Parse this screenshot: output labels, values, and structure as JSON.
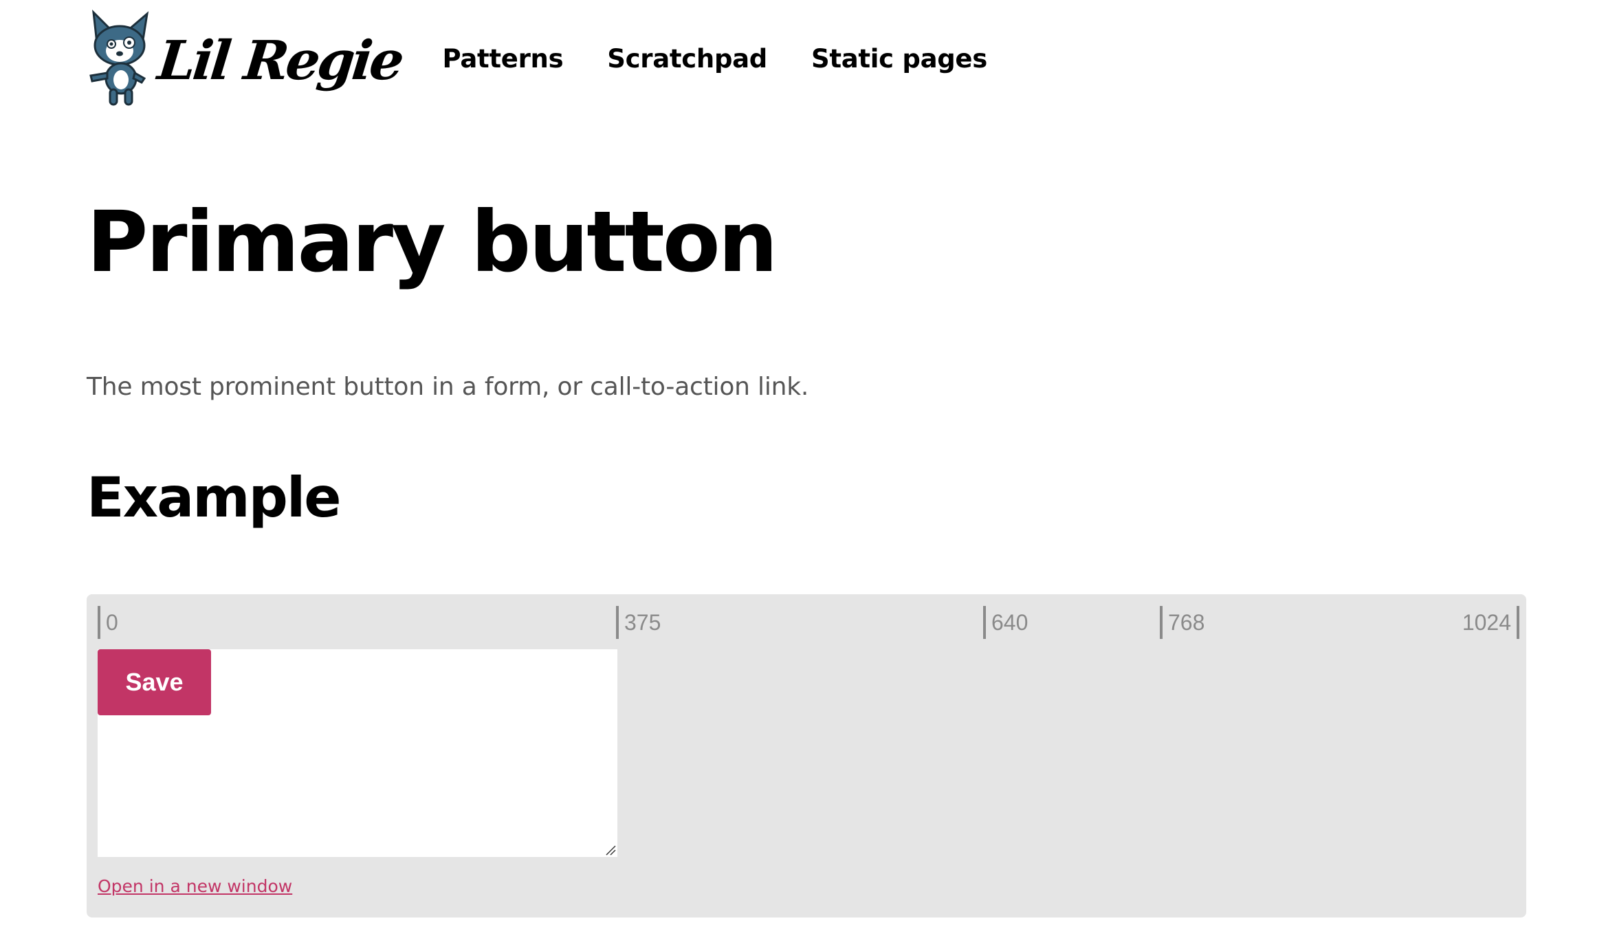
{
  "header": {
    "logo_text": "Lil Regie",
    "nav": [
      {
        "label": "Patterns"
      },
      {
        "label": "Scratchpad"
      },
      {
        "label": "Static pages"
      }
    ]
  },
  "main": {
    "title": "Primary button",
    "description": "The most prominent button in a form, or call-to-action link.",
    "section_title": "Example"
  },
  "example": {
    "ruler": [
      "0",
      "375",
      "640",
      "768",
      "1024"
    ],
    "save_label": "Save",
    "open_link_label": "Open in a new window"
  },
  "colors": {
    "accent": "#c23566",
    "panel_bg": "#e5e5e5",
    "logo_blue": "#3d6a86"
  }
}
